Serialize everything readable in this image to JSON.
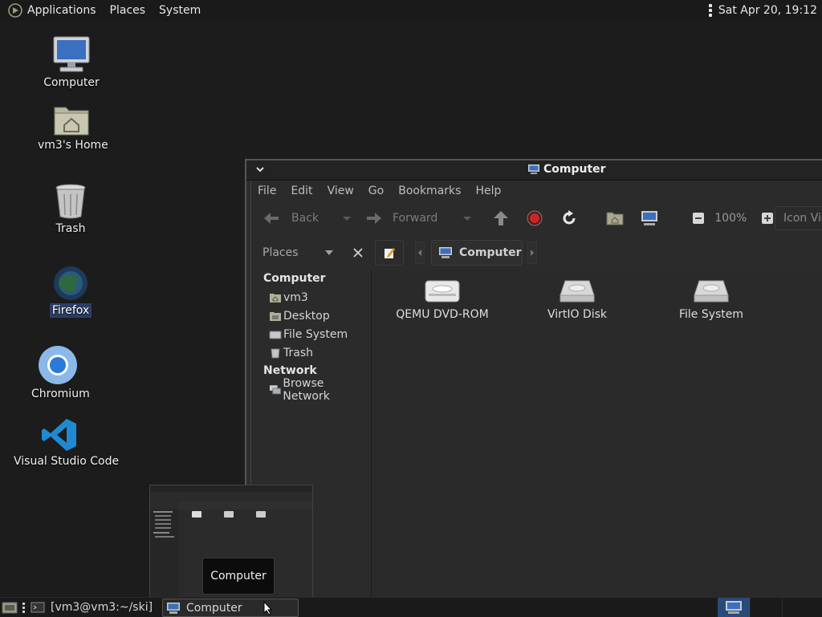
{
  "top_panel": {
    "menus": [
      "Applications",
      "Places",
      "System"
    ],
    "clock": "Sat Apr 20, 19:12"
  },
  "desktop": {
    "icons": [
      {
        "label": "Computer",
        "icon": "computer-icon"
      },
      {
        "label": "vm3's Home",
        "icon": "home-folder-icon"
      },
      {
        "label": "Trash",
        "icon": "trash-icon"
      },
      {
        "label": "Firefox",
        "icon": "firefox-icon",
        "selected": true
      },
      {
        "label": "Chromium",
        "icon": "chromium-icon"
      },
      {
        "label": "Visual Studio Code",
        "icon": "vscode-icon"
      }
    ]
  },
  "window": {
    "title": "Computer",
    "menubar": [
      "File",
      "Edit",
      "View",
      "Go",
      "Bookmarks",
      "Help"
    ],
    "toolbar": {
      "back_label": "Back",
      "forward_label": "Forward",
      "zoom": "100%",
      "view_mode": "Icon View"
    },
    "sidebar": {
      "header": "Places",
      "groups": [
        {
          "name": "Computer",
          "items": [
            "vm3",
            "Desktop",
            "File System",
            "Trash"
          ]
        },
        {
          "name": "Network",
          "items": [
            "Browse Network"
          ]
        }
      ]
    },
    "location": {
      "crumb": "Computer"
    },
    "items": [
      {
        "label": "QEMU DVD-ROM",
        "icon": "optical-drive-icon"
      },
      {
        "label": "VirtIO Disk",
        "icon": "hard-disk-icon"
      },
      {
        "label": "File System",
        "icon": "hard-disk-icon"
      }
    ]
  },
  "thumbnail": {
    "tooltip": "Computer"
  },
  "taskbar": {
    "tasks": [
      {
        "label": "[vm3@vm3:~/ski]",
        "icon": "terminal-icon"
      },
      {
        "label": "Computer",
        "icon": "computer-icon"
      }
    ]
  },
  "colors": {
    "desktop_bg": "#1c1c1c",
    "panel_bg": "#1a1a1a",
    "window_bg": "#2b2b2b",
    "selection": "#2c3e66",
    "stop_red": "#c62828",
    "workspace_active": "#2a4a7a"
  }
}
